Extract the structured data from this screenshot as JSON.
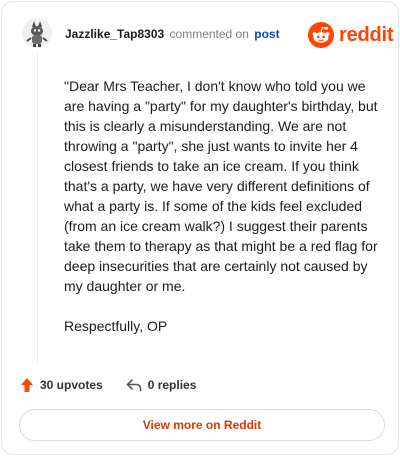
{
  "header": {
    "username": "Jazzlike_Tap8303",
    "action": "commented on",
    "post_link": "post"
  },
  "brand": {
    "name": "reddit",
    "color": "#ff4500"
  },
  "comment": {
    "paragraphs": [
      "\"Dear Mrs Teacher, I don't know who told you we are having a \"party\" for my daughter's birthday, but this is clearly a misunderstanding. We are not throwing a \"party\", she just wants to invite her 4 closest friends to take an ice cream. If you think that's a party, we have very different definitions of what a party is. If some of the kids feel excluded (from an ice cream walk?) I suggest their parents take them to therapy as that might be a red flag for deep insecurities that are certainly not caused by my daughter or me.",
      "Respectfully, OP"
    ]
  },
  "stats": {
    "upvotes": "30 upvotes",
    "replies": "0 replies"
  },
  "footer": {
    "button_label": "View more on Reddit"
  },
  "icons": {
    "avatar": "avatar-icon",
    "logo": "reddit-logo-icon",
    "upvote": "upvote-arrow-icon",
    "reply": "reply-arrow-icon"
  },
  "colors": {
    "upvote": "#ff4500",
    "link": "#0a4fa8",
    "button_text": "#d93900"
  }
}
